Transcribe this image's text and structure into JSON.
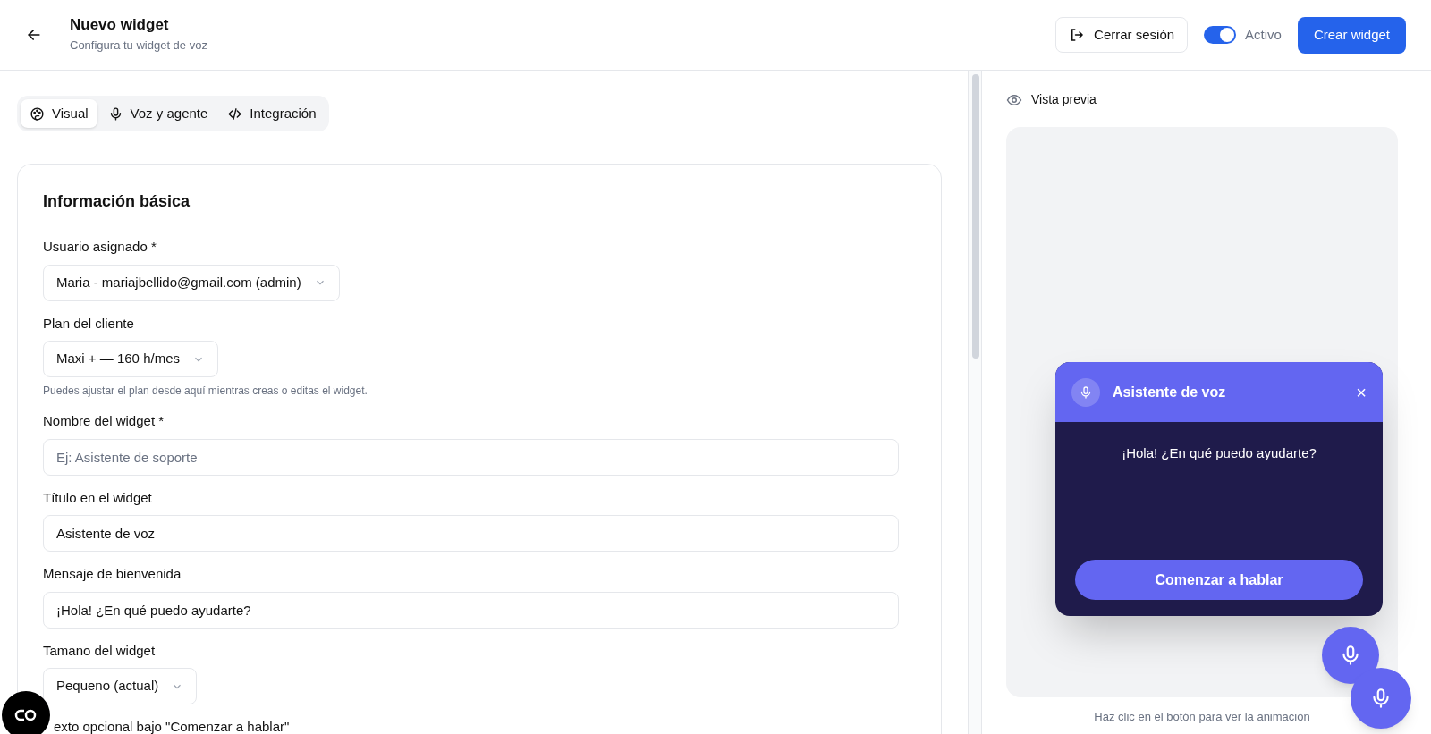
{
  "header": {
    "title": "Nuevo widget",
    "subtitle": "Configura tu widget de voz",
    "logout": "Cerrar sesión",
    "active_toggle": {
      "label": "Activo",
      "on": true
    },
    "create": "Crear widget"
  },
  "tabs": [
    {
      "label": "Visual",
      "kind": "palette",
      "selected": true
    },
    {
      "label": "Voz y agente",
      "kind": "mic",
      "selected": false
    },
    {
      "label": "Integración",
      "kind": "code",
      "selected": false
    }
  ],
  "card": {
    "title": "Información básica",
    "fields": [
      {
        "label": "Usuario asignado *",
        "kind": "select",
        "value": "Maria - mariajbellido@gmail.com (admin)"
      },
      {
        "label": "Plan del cliente",
        "kind": "select",
        "value": "Maxi + — 160 h/mes",
        "help": "Puedes ajustar el plan desde aquí mientras creas o editas el widget."
      },
      {
        "label": "Nombre del widget *",
        "kind": "input",
        "placeholder": "Ej: Asistente de soporte"
      },
      {
        "label": "Título en el widget",
        "kind": "input",
        "value": "Asistente de voz"
      },
      {
        "label": "Mensaje de bienvenida",
        "kind": "input",
        "value": "¡Hola! ¿En qué puedo ayudarte?"
      },
      {
        "label": "Tamano del widget",
        "kind": "select",
        "value": "Pequeno (actual)"
      },
      {
        "label": "exto opcional bajo \"Comenzar a hablar\"",
        "kind": "label"
      }
    ]
  },
  "preview": {
    "title": "Vista previa",
    "widget_title": "Asistente de voz",
    "close": "×",
    "welcome": "¡Hola! ¿En qué puedo ayudarte?",
    "start": "Comenzar a hablar",
    "hint": "Haz clic en el botón para ver la animación"
  }
}
